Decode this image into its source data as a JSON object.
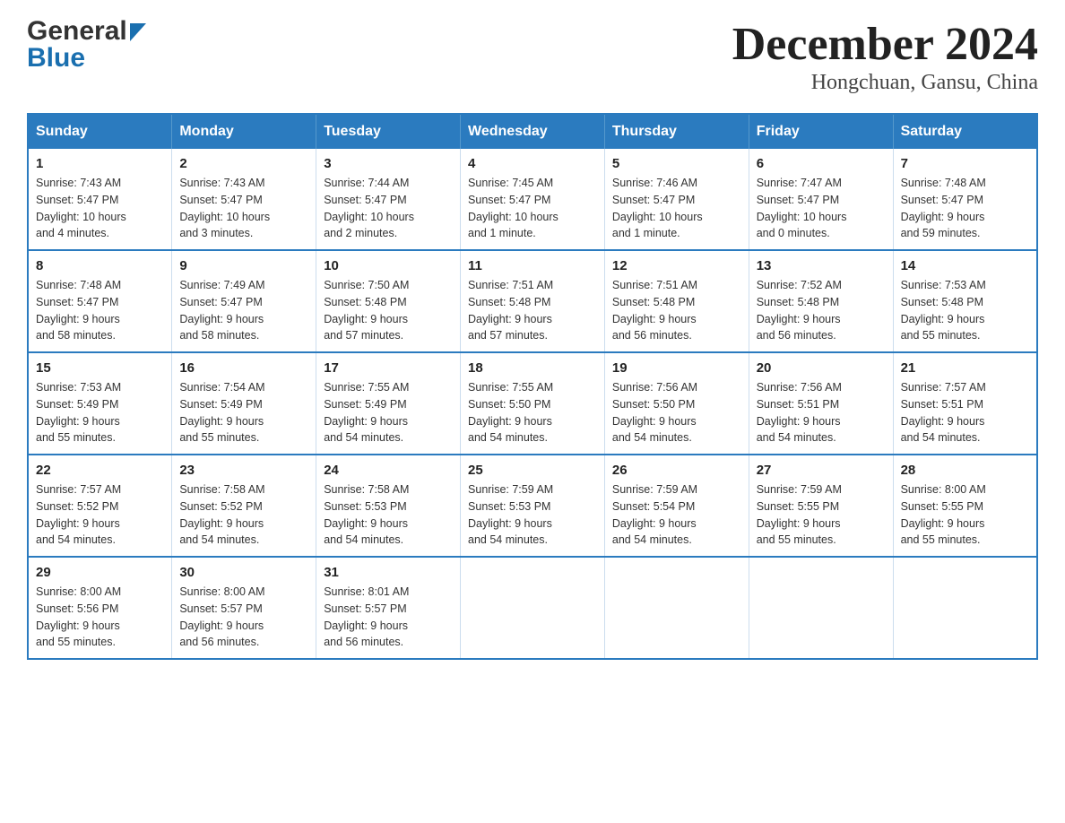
{
  "header": {
    "logo_general": "General",
    "logo_blue": "Blue",
    "month_title": "December 2024",
    "location": "Hongchuan, Gansu, China"
  },
  "weekdays": [
    "Sunday",
    "Monday",
    "Tuesday",
    "Wednesday",
    "Thursday",
    "Friday",
    "Saturday"
  ],
  "weeks": [
    [
      {
        "day": "1",
        "sunrise": "7:43 AM",
        "sunset": "5:47 PM",
        "daylight": "10 hours and 4 minutes."
      },
      {
        "day": "2",
        "sunrise": "7:43 AM",
        "sunset": "5:47 PM",
        "daylight": "10 hours and 3 minutes."
      },
      {
        "day": "3",
        "sunrise": "7:44 AM",
        "sunset": "5:47 PM",
        "daylight": "10 hours and 2 minutes."
      },
      {
        "day": "4",
        "sunrise": "7:45 AM",
        "sunset": "5:47 PM",
        "daylight": "10 hours and 1 minute."
      },
      {
        "day": "5",
        "sunrise": "7:46 AM",
        "sunset": "5:47 PM",
        "daylight": "10 hours and 1 minute."
      },
      {
        "day": "6",
        "sunrise": "7:47 AM",
        "sunset": "5:47 PM",
        "daylight": "10 hours and 0 minutes."
      },
      {
        "day": "7",
        "sunrise": "7:48 AM",
        "sunset": "5:47 PM",
        "daylight": "9 hours and 59 minutes."
      }
    ],
    [
      {
        "day": "8",
        "sunrise": "7:48 AM",
        "sunset": "5:47 PM",
        "daylight": "9 hours and 58 minutes."
      },
      {
        "day": "9",
        "sunrise": "7:49 AM",
        "sunset": "5:47 PM",
        "daylight": "9 hours and 58 minutes."
      },
      {
        "day": "10",
        "sunrise": "7:50 AM",
        "sunset": "5:48 PM",
        "daylight": "9 hours and 57 minutes."
      },
      {
        "day": "11",
        "sunrise": "7:51 AM",
        "sunset": "5:48 PM",
        "daylight": "9 hours and 57 minutes."
      },
      {
        "day": "12",
        "sunrise": "7:51 AM",
        "sunset": "5:48 PM",
        "daylight": "9 hours and 56 minutes."
      },
      {
        "day": "13",
        "sunrise": "7:52 AM",
        "sunset": "5:48 PM",
        "daylight": "9 hours and 56 minutes."
      },
      {
        "day": "14",
        "sunrise": "7:53 AM",
        "sunset": "5:48 PM",
        "daylight": "9 hours and 55 minutes."
      }
    ],
    [
      {
        "day": "15",
        "sunrise": "7:53 AM",
        "sunset": "5:49 PM",
        "daylight": "9 hours and 55 minutes."
      },
      {
        "day": "16",
        "sunrise": "7:54 AM",
        "sunset": "5:49 PM",
        "daylight": "9 hours and 55 minutes."
      },
      {
        "day": "17",
        "sunrise": "7:55 AM",
        "sunset": "5:49 PM",
        "daylight": "9 hours and 54 minutes."
      },
      {
        "day": "18",
        "sunrise": "7:55 AM",
        "sunset": "5:50 PM",
        "daylight": "9 hours and 54 minutes."
      },
      {
        "day": "19",
        "sunrise": "7:56 AM",
        "sunset": "5:50 PM",
        "daylight": "9 hours and 54 minutes."
      },
      {
        "day": "20",
        "sunrise": "7:56 AM",
        "sunset": "5:51 PM",
        "daylight": "9 hours and 54 minutes."
      },
      {
        "day": "21",
        "sunrise": "7:57 AM",
        "sunset": "5:51 PM",
        "daylight": "9 hours and 54 minutes."
      }
    ],
    [
      {
        "day": "22",
        "sunrise": "7:57 AM",
        "sunset": "5:52 PM",
        "daylight": "9 hours and 54 minutes."
      },
      {
        "day": "23",
        "sunrise": "7:58 AM",
        "sunset": "5:52 PM",
        "daylight": "9 hours and 54 minutes."
      },
      {
        "day": "24",
        "sunrise": "7:58 AM",
        "sunset": "5:53 PM",
        "daylight": "9 hours and 54 minutes."
      },
      {
        "day": "25",
        "sunrise": "7:59 AM",
        "sunset": "5:53 PM",
        "daylight": "9 hours and 54 minutes."
      },
      {
        "day": "26",
        "sunrise": "7:59 AM",
        "sunset": "5:54 PM",
        "daylight": "9 hours and 54 minutes."
      },
      {
        "day": "27",
        "sunrise": "7:59 AM",
        "sunset": "5:55 PM",
        "daylight": "9 hours and 55 minutes."
      },
      {
        "day": "28",
        "sunrise": "8:00 AM",
        "sunset": "5:55 PM",
        "daylight": "9 hours and 55 minutes."
      }
    ],
    [
      {
        "day": "29",
        "sunrise": "8:00 AM",
        "sunset": "5:56 PM",
        "daylight": "9 hours and 55 minutes."
      },
      {
        "day": "30",
        "sunrise": "8:00 AM",
        "sunset": "5:57 PM",
        "daylight": "9 hours and 56 minutes."
      },
      {
        "day": "31",
        "sunrise": "8:01 AM",
        "sunset": "5:57 PM",
        "daylight": "9 hours and 56 minutes."
      },
      null,
      null,
      null,
      null
    ]
  ],
  "labels": {
    "sunrise": "Sunrise:",
    "sunset": "Sunset:",
    "daylight": "Daylight:"
  }
}
